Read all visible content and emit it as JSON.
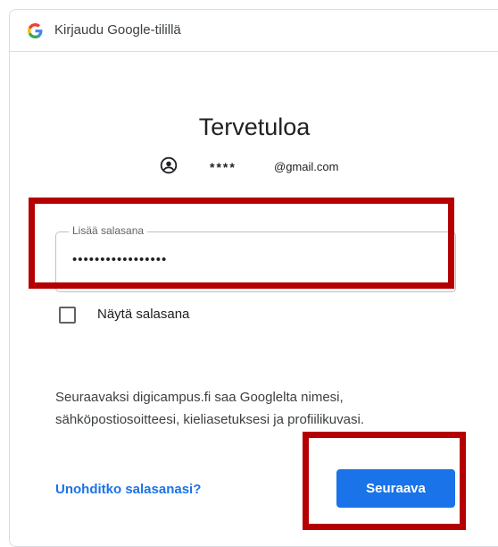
{
  "header": {
    "title": "Kirjaudu Google-tilillä",
    "logo_icon": "google-g-icon"
  },
  "welcome": {
    "title": "Tervetuloa"
  },
  "account": {
    "icon": "account-circle-icon",
    "masked": "****",
    "domain": "@gmail.com"
  },
  "password": {
    "label": "Lisää salasana",
    "value": "•••••••••••••••••"
  },
  "show_password": {
    "label": "Näytä salasana",
    "checked": false
  },
  "info": {
    "text": "Seuraavaksi digicampus.fi saa Googlelta nimesi, sähköpostiosoitteesi, kieliasetuksesi ja profiilikuvasi."
  },
  "actions": {
    "forgot": "Unohditko salasanasi?",
    "next": "Seuraava"
  },
  "colors": {
    "accent": "#1a73e8",
    "highlight": "#b40000",
    "border": "#dadce0"
  }
}
